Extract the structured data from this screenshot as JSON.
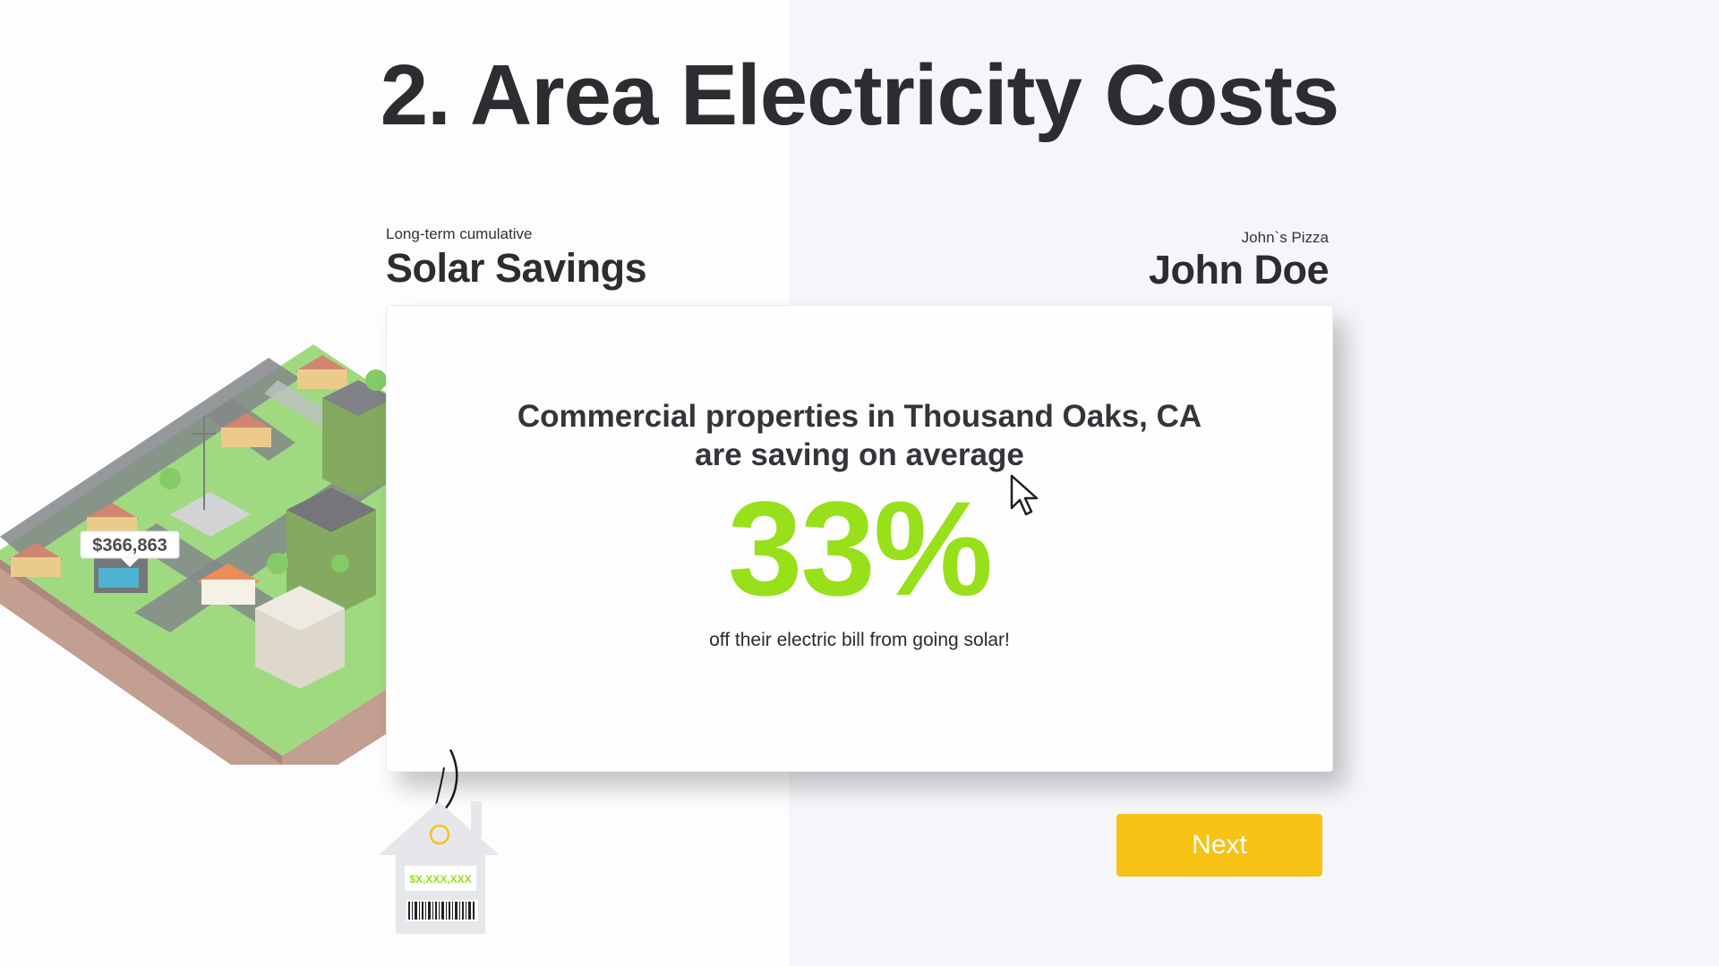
{
  "page": {
    "title": "2. Area Electricity Costs"
  },
  "savings_header": {
    "caption": "Long-term cumulative",
    "heading": "Solar Savings"
  },
  "customer": {
    "company": "John`s Pizza",
    "name": "John Doe"
  },
  "illustration": {
    "price_label": "$366,863",
    "tag_price": "$X,XXX,XXX"
  },
  "card": {
    "lead_line1": "Commercial properties in Thousand Oaks, CA",
    "lead_line2": "are saving on average",
    "percent": "33%",
    "subtext": "off their electric bill from going solar!"
  },
  "actions": {
    "next_label": "Next"
  },
  "colors": {
    "accent_green": "#97e01a",
    "button_yellow": "#f6c315",
    "text_dark": "#2c2d31"
  }
}
